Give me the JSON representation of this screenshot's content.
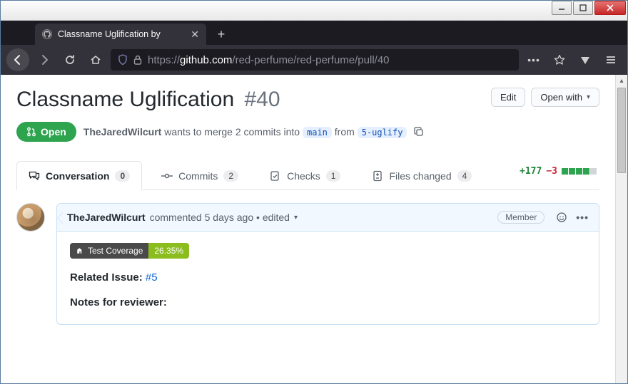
{
  "os": {
    "min_tooltip": "Minimize",
    "max_tooltip": "Maximize",
    "close_tooltip": "Close"
  },
  "browser": {
    "tab_title": "Classname Uglification by",
    "newtab_label": "+",
    "url_display_prefix": "https://",
    "url_host": "github.com",
    "url_path": "/red-perfume/red-perfume/pull/40"
  },
  "pr": {
    "title": "Classname Uglification",
    "number": "#40",
    "edit_label": "Edit",
    "open_with_label": "Open with",
    "state_label": "Open",
    "author": "TheJaredWilcurt",
    "merge_text_1": " wants to merge 2 commits into ",
    "base_branch": "main",
    "merge_text_2": " from ",
    "head_branch": "5-uglify"
  },
  "tabs": {
    "conversation": {
      "label": "Conversation",
      "count": "0"
    },
    "commits": {
      "label": "Commits",
      "count": "2"
    },
    "checks": {
      "label": "Checks",
      "count": "1"
    },
    "files": {
      "label": "Files changed",
      "count": "4"
    },
    "additions": "+177",
    "deletions": "−3"
  },
  "comment": {
    "author": "TheJaredWilcurt",
    "action": " commented ",
    "time": "5 days ago",
    "sep": " • ",
    "edited": "edited",
    "role": "Member",
    "coverage_label": "Test Coverage",
    "coverage_value": "26.35%",
    "related_label": "Related Issue: ",
    "related_link": "#5",
    "notes_label": "Notes for reviewer:"
  }
}
